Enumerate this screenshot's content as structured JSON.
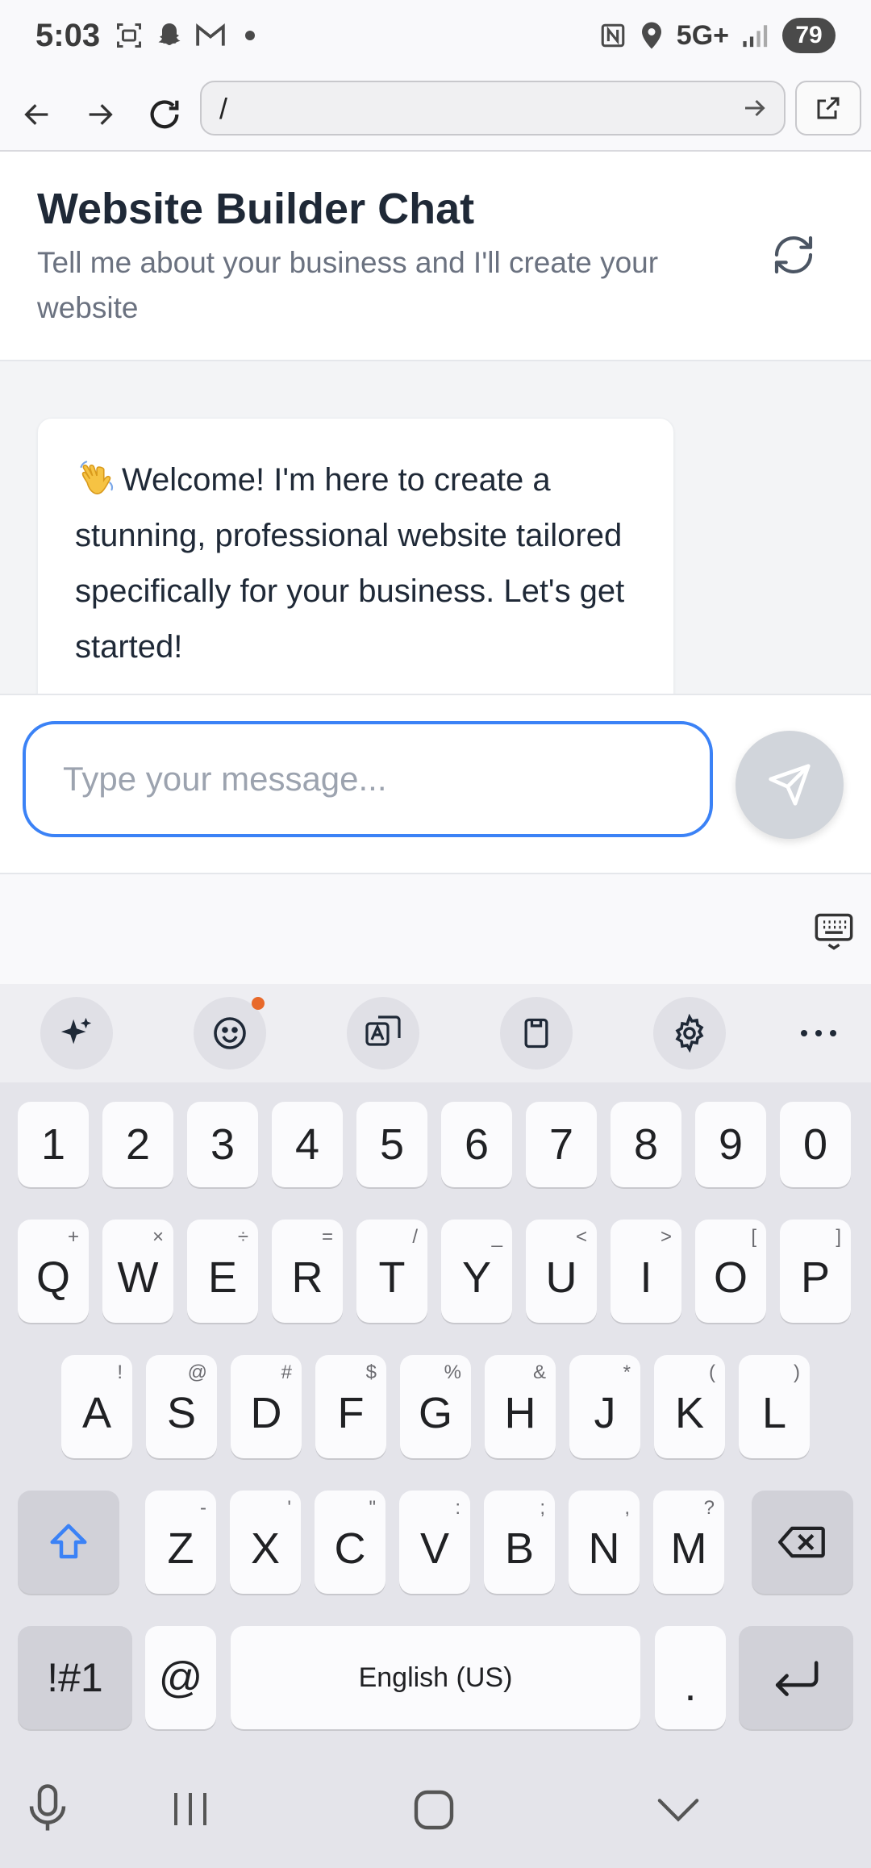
{
  "status_bar": {
    "time": "5:03",
    "network": "5G+",
    "battery": "79",
    "icons": [
      "screenshot-icon",
      "snapchat-icon",
      "gmail-icon",
      "dot-icon",
      "nfc-icon",
      "location-icon",
      "signal-icon"
    ]
  },
  "browser": {
    "url": "/",
    "icons": [
      "back-arrow-icon",
      "forward-arrow-icon",
      "reload-icon",
      "go-arrow-icon",
      "external-link-icon"
    ]
  },
  "header": {
    "title": "Website Builder Chat",
    "subtitle": "Tell me about your business and I'll create your website"
  },
  "chat": {
    "messages": [
      {
        "emoji": "waving-hand",
        "text": "Welcome! I'm here to create a stunning, professional website tailored specifically for your business. Let's get started!"
      }
    ]
  },
  "input": {
    "placeholder": "Type your message..."
  },
  "keyboard": {
    "number_row": [
      "1",
      "2",
      "3",
      "4",
      "5",
      "6",
      "7",
      "8",
      "9",
      "0"
    ],
    "row1": [
      {
        "k": "Q",
        "s": "+"
      },
      {
        "k": "W",
        "s": "×"
      },
      {
        "k": "E",
        "s": "÷"
      },
      {
        "k": "R",
        "s": "="
      },
      {
        "k": "T",
        "s": "/"
      },
      {
        "k": "Y",
        "s": "_"
      },
      {
        "k": "U",
        "s": "<"
      },
      {
        "k": "I",
        "s": ">"
      },
      {
        "k": "O",
        "s": "["
      },
      {
        "k": "P",
        "s": "]"
      }
    ],
    "row2": [
      {
        "k": "A",
        "s": "!"
      },
      {
        "k": "S",
        "s": "@"
      },
      {
        "k": "D",
        "s": "#"
      },
      {
        "k": "F",
        "s": "$"
      },
      {
        "k": "G",
        "s": "%"
      },
      {
        "k": "H",
        "s": "&"
      },
      {
        "k": "J",
        "s": "*"
      },
      {
        "k": "K",
        "s": "("
      },
      {
        "k": "L",
        "s": ")"
      }
    ],
    "row3": [
      {
        "k": "Z",
        "s": "-"
      },
      {
        "k": "X",
        "s": "'"
      },
      {
        "k": "C",
        "s": "\""
      },
      {
        "k": "V",
        "s": ":"
      },
      {
        "k": "B",
        "s": ";"
      },
      {
        "k": "N",
        "s": ","
      },
      {
        "k": "M",
        "s": "?"
      }
    ],
    "symbols_key": "!#1",
    "at_key": "@",
    "space_label": "English (US)",
    "period_key": ".",
    "accent_color": "#3b82f6"
  }
}
